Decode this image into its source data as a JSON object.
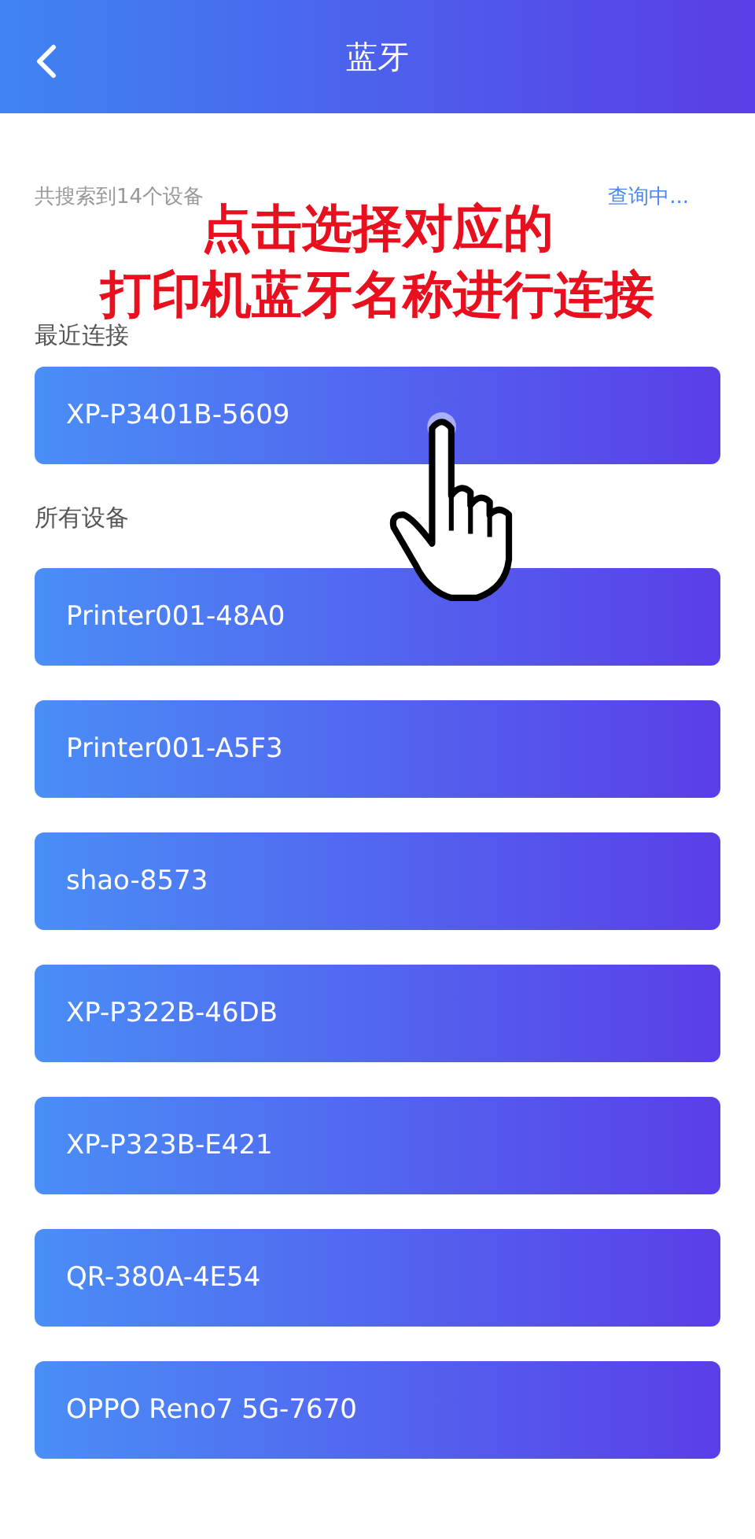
{
  "header": {
    "title": "蓝牙"
  },
  "search_status": {
    "count_text": "共搜索到14个设备",
    "state_text": "查询中..."
  },
  "recent": {
    "label": "最近连接",
    "devices": [
      {
        "name": "XP-P3401B-5609"
      }
    ]
  },
  "all": {
    "label": "所有设备",
    "devices": [
      {
        "name": "Printer001-48A0"
      },
      {
        "name": "Printer001-A5F3"
      },
      {
        "name": "shao-8573"
      },
      {
        "name": "XP-P322B-46DB"
      },
      {
        "name": "XP-P323B-E421"
      },
      {
        "name": "QR-380A-4E54"
      },
      {
        "name": "OPPO Reno7 5G-7670"
      }
    ]
  },
  "annotation": {
    "lines": [
      "点击选择对应的",
      "打印机蓝牙名称进行连接"
    ]
  }
}
